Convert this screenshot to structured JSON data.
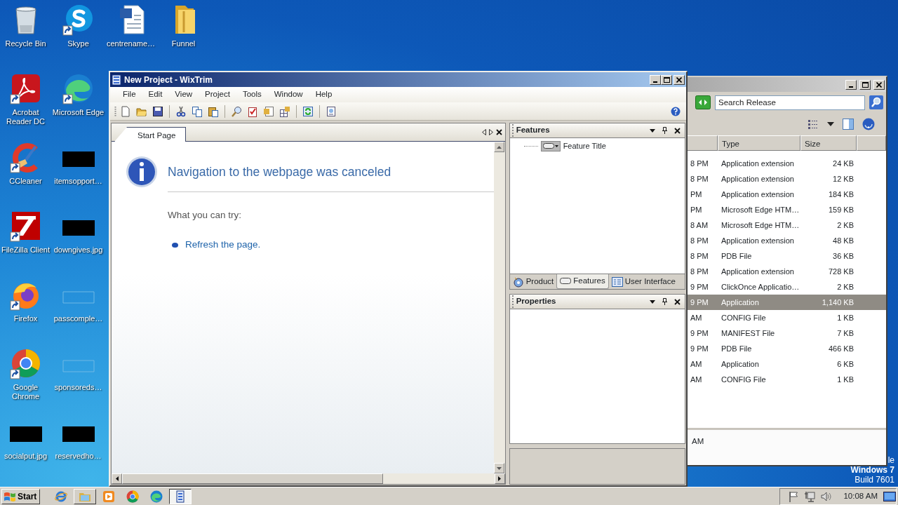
{
  "desktop": {
    "icon_columns": [
      [
        {
          "label": "Recycle Bin",
          "kind": "bin",
          "shortcut": false
        },
        {
          "label": "Acrobat Reader DC",
          "kind": "acrobat",
          "shortcut": true
        },
        {
          "label": "CCleaner",
          "kind": "ccleaner",
          "shortcut": true
        },
        {
          "label": "FileZilla Client",
          "kind": "filezilla",
          "shortcut": true
        },
        {
          "label": "Firefox",
          "kind": "firefox",
          "shortcut": true
        },
        {
          "label": "Google Chrome",
          "kind": "chrome",
          "shortcut": true
        },
        {
          "label": "socialput.jpg",
          "kind": "redacted",
          "shortcut": false
        }
      ],
      [
        {
          "label": "Skype",
          "kind": "skype",
          "shortcut": true
        },
        {
          "label": "Microsoft Edge",
          "kind": "edge",
          "shortcut": true
        },
        {
          "label": "itemsopport…",
          "kind": "redacted",
          "shortcut": false
        },
        {
          "label": "downgives.jpg",
          "kind": "redacted",
          "shortcut": false
        },
        {
          "label": "passcomple…",
          "kind": "blank",
          "shortcut": false
        },
        {
          "label": "sponsoreds…",
          "kind": "blank",
          "shortcut": false
        },
        {
          "label": "reservedho…",
          "kind": "redacted",
          "shortcut": false
        }
      ],
      [
        {
          "label": "centrename…",
          "kind": "word",
          "shortcut": false
        }
      ],
      [
        {
          "label": "Funnel",
          "kind": "folder",
          "shortcut": false
        }
      ]
    ],
    "os_notice": {
      "fragment": "le",
      "edition": "Windows 7",
      "build": "Build 7601"
    }
  },
  "explorer": {
    "search": {
      "placeholder": "Search Release"
    },
    "columns": [
      "Type",
      "Size"
    ],
    "rows": [
      {
        "column_1": "8 PM",
        "type": "Application extension",
        "size": "24 KB",
        "selected": false
      },
      {
        "column_1": "8 PM",
        "type": "Application extension",
        "size": "12 KB",
        "selected": false
      },
      {
        "column_1": "PM",
        "type": "Application extension",
        "size": "184 KB",
        "selected": false
      },
      {
        "column_1": "PM",
        "type": "Microsoft Edge HTM…",
        "size": "159 KB",
        "selected": false
      },
      {
        "column_1": "8 AM",
        "type": "Microsoft Edge HTM…",
        "size": "2 KB",
        "selected": false
      },
      {
        "column_1": "8 PM",
        "type": "Application extension",
        "size": "48 KB",
        "selected": false
      },
      {
        "column_1": "8 PM",
        "type": "PDB File",
        "size": "36 KB",
        "selected": false
      },
      {
        "column_1": "8 PM",
        "type": "Application extension",
        "size": "728 KB",
        "selected": false
      },
      {
        "column_1": "9 PM",
        "type": "ClickOnce Applicatio…",
        "size": "2 KB",
        "selected": false
      },
      {
        "column_1": "9 PM",
        "type": "Application",
        "size": "1,140 KB",
        "selected": true
      },
      {
        "column_1": "AM",
        "type": "CONFIG File",
        "size": "1 KB",
        "selected": false
      },
      {
        "column_1": "9 PM",
        "type": "MANIFEST File",
        "size": "7 KB",
        "selected": false
      },
      {
        "column_1": "9 PM",
        "type": "PDB File",
        "size": "466 KB",
        "selected": false
      },
      {
        "column_1": "AM",
        "type": "Application",
        "size": "6 KB",
        "selected": false
      },
      {
        "column_1": "AM",
        "type": "CONFIG File",
        "size": "1 KB",
        "selected": false
      }
    ],
    "details": "AM"
  },
  "window": {
    "title": "New Project - WixTrim",
    "menu": [
      "File",
      "Edit",
      "View",
      "Project",
      "Tools",
      "Window",
      "Help"
    ],
    "document_tabs": [
      {
        "label": "Start Page",
        "selected": true
      }
    ],
    "start_page": {
      "heading": "Navigation to the webpage was canceled",
      "subheading": "What you can try:",
      "links": [
        "Refresh the page."
      ]
    },
    "features_panel": {
      "title": "Features",
      "tree": [
        {
          "label": "Feature Title"
        }
      ],
      "tabs": [
        {
          "label": "Product",
          "kind": "product",
          "selected": false
        },
        {
          "label": "Features",
          "kind": "features",
          "selected": true
        },
        {
          "label": "User Interface",
          "kind": "ui",
          "selected": false
        }
      ]
    },
    "properties_panel": {
      "title": "Properties"
    }
  },
  "taskbar": {
    "start": "Start",
    "apps": [
      {
        "kind": "ie",
        "open": false,
        "active": false
      },
      {
        "kind": "explorer",
        "open": true,
        "active": false
      },
      {
        "kind": "media",
        "open": false,
        "active": false
      },
      {
        "kind": "chrome",
        "open": false,
        "active": false
      },
      {
        "kind": "edge",
        "open": false,
        "active": false
      },
      {
        "kind": "wixtrim",
        "open": true,
        "active": true
      }
    ],
    "clock": "10:08 AM"
  }
}
